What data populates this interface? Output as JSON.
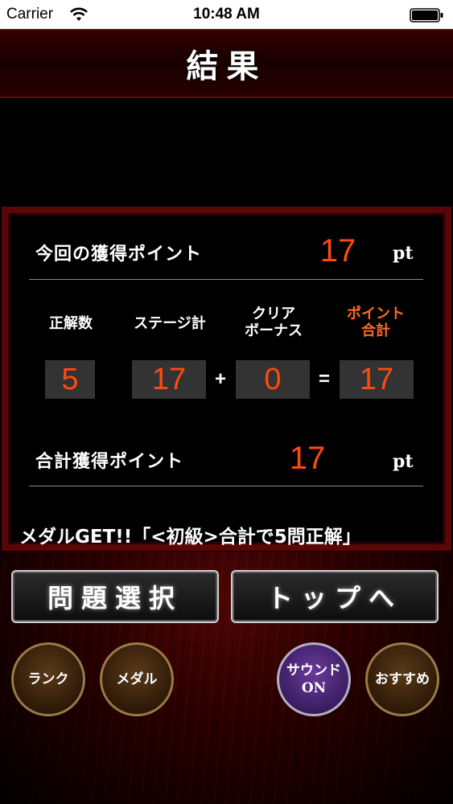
{
  "status_bar": {
    "carrier": "Carrier",
    "time": "10:48 AM"
  },
  "header": {
    "title": "結果"
  },
  "results": {
    "current_points_label": "今回の獲得ポイント",
    "current_points_value": "17",
    "current_points_unit": "pt",
    "columns": {
      "correct": "正解数",
      "stage_total": "ステージ計",
      "clear_bonus_line1": "クリア",
      "clear_bonus_line2": "ボーナス",
      "points_total_line1": "ポイント",
      "points_total_line2": "合計"
    },
    "values": {
      "correct": "5",
      "stage_total": "17",
      "clear_bonus": "0",
      "points_total": "17"
    },
    "operators": {
      "plus": "+",
      "equals": "="
    },
    "total_points_label": "合計獲得ポイント",
    "total_points_value": "17",
    "total_points_unit": "pt",
    "medal_message": "メダルGET!!「<初級>合計で5問正解」"
  },
  "buttons": {
    "question_select": "問題選択",
    "to_top": "トップへ",
    "rank": "ランク",
    "medal": "メダル",
    "sound_line1": "サウンド",
    "sound_line2": "ON",
    "recommend": "おすすめ"
  },
  "colors": {
    "accent": "#ff4a12",
    "panel_border": "#5a0606",
    "sound_button": "#3b1d62"
  },
  "icons": {
    "wifi": "wifi-icon",
    "battery": "battery-icon"
  }
}
